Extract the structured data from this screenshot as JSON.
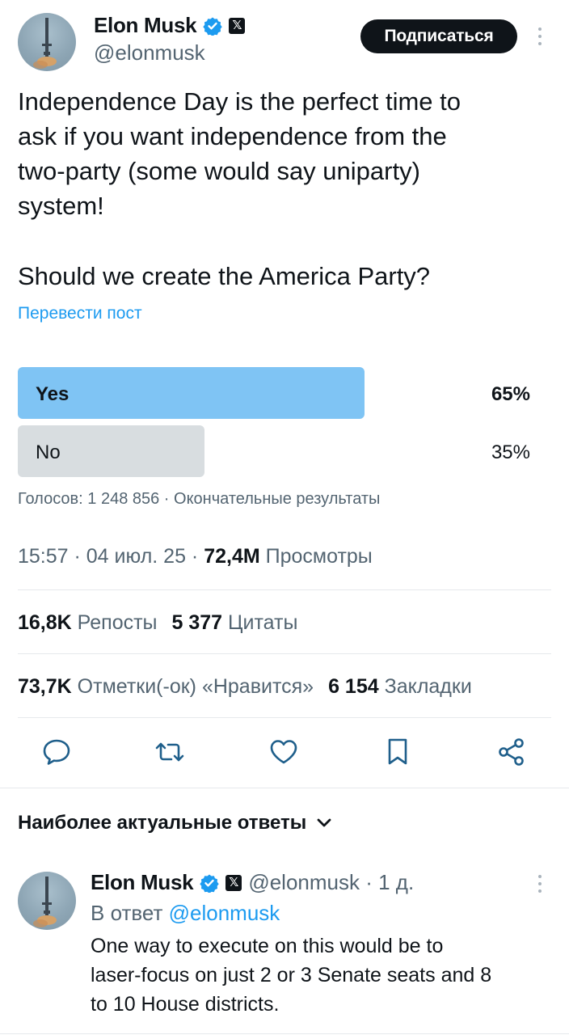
{
  "author": {
    "name": "Elon Musk",
    "handle": "@elonmusk",
    "badge_icon": "verified-badge-icon",
    "affiliation_icon": "x-logo-icon"
  },
  "header": {
    "subscribe_label": "Подписаться"
  },
  "post": {
    "lines_p1": [
      "Independence Day is the perfect time to",
      "ask if you want independence from the",
      "two-party (some would say uniparty)",
      "system!"
    ],
    "line_p2": "Should we create the America Party?",
    "translate_label": "Перевести пост"
  },
  "poll": {
    "options": [
      {
        "label": "Yes",
        "percent": "65%",
        "fraction": 0.65,
        "winner": true
      },
      {
        "label": "No",
        "percent": "35%",
        "fraction": 0.35,
        "winner": false
      }
    ],
    "meta": "Голосов: 1 248 856 · Окончательные результаты"
  },
  "timestamp": {
    "time": "15:57 · 04 июл. 25 · ",
    "views_count": "72,4M",
    "views_label": " Просмотры"
  },
  "stats": {
    "reposts_count": "16,8K",
    "reposts_label": "Репосты",
    "quotes_count": "5 377",
    "quotes_label": "Цитаты",
    "likes_count": "73,7K",
    "likes_label": "Отметки(-ок) «Нравится»",
    "bookmarks_count": "6 154",
    "bookmarks_label": "Закладки"
  },
  "actions": [
    "reply-icon",
    "repost-icon",
    "like-icon",
    "bookmark-icon",
    "share-icon"
  ],
  "replies": {
    "header": "Наиболее актуальные ответы",
    "first": {
      "name": "Elon Musk",
      "meta": "@elonmusk · 1 д.",
      "reply_prefix": "В ответ ",
      "reply_to": "@elonmusk",
      "lines": [
        "One way to execute on this would be to",
        "laser-focus on just 2 or 3 Senate seats and 8",
        "to 10 House districts."
      ]
    }
  },
  "colors": {
    "accent": "#1d9bf0",
    "poll_winner": "#7fc4f4",
    "poll_loser": "#d8dde0",
    "text": "#0f1419",
    "muted": "#536471"
  }
}
